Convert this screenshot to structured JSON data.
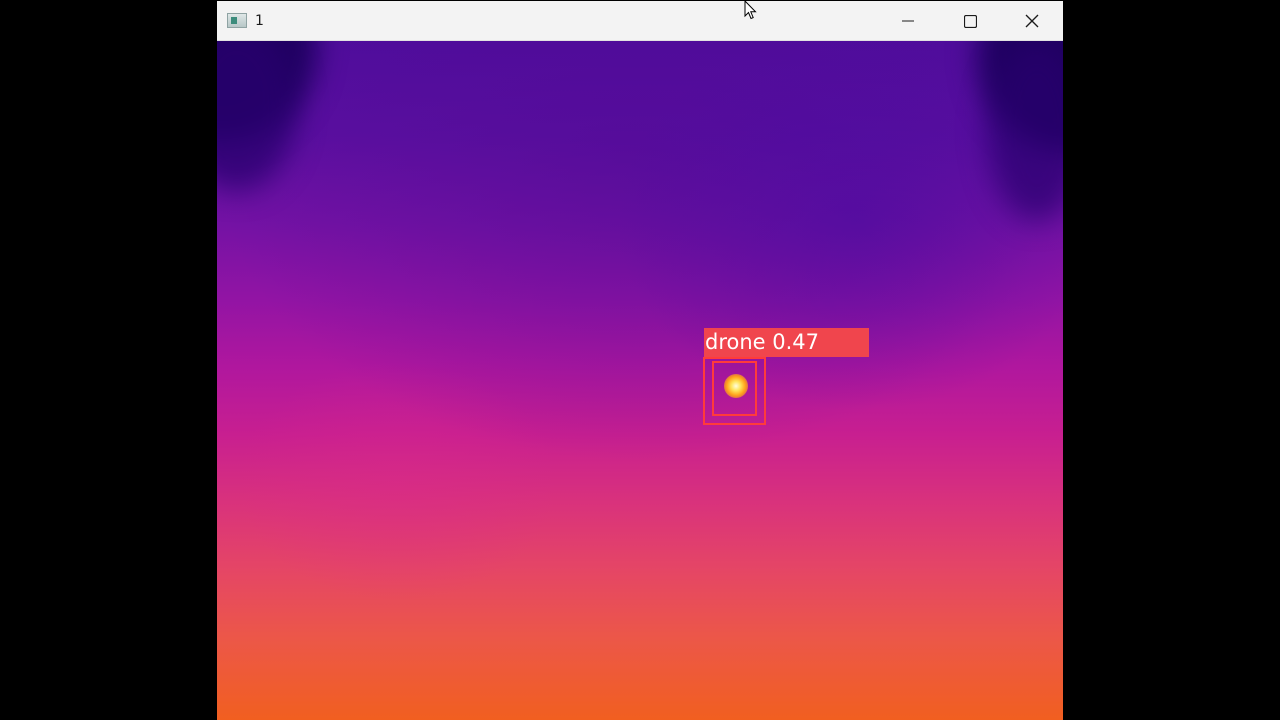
{
  "window": {
    "title": "1",
    "icon": "opencv-window-icon",
    "controls": {
      "minimize_icon": "minimize-icon",
      "maximize_icon": "maximize-icon",
      "close_icon": "close-icon"
    }
  },
  "image": {
    "palette": {
      "top": "#4f0d9c",
      "middle": "#b0179e",
      "bottom": "#f15f20"
    },
    "detection": {
      "label": "drone 0.47",
      "color": "#f0454d"
    }
  }
}
